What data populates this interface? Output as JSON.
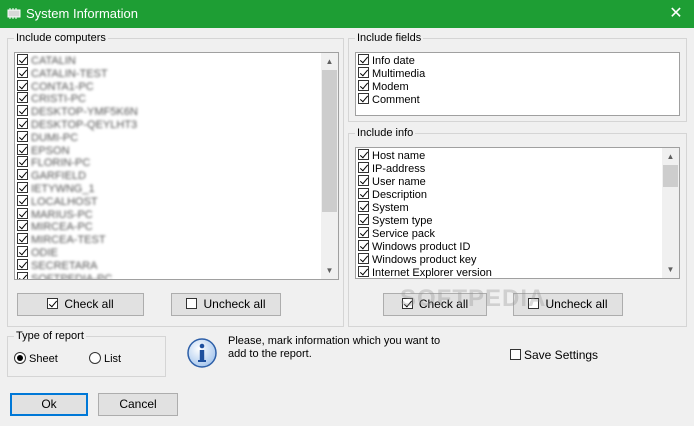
{
  "window": {
    "title": "System Information",
    "close_icon": "close-icon",
    "app_icon": "chip-icon",
    "accent": "#1e9e34"
  },
  "computers": {
    "label": "Include computers",
    "items": [
      {
        "label": "CATALIN",
        "checked": true
      },
      {
        "label": "CATALIN-TEST",
        "checked": true
      },
      {
        "label": "CONTA1-PC",
        "checked": true
      },
      {
        "label": "CRISTI-PC",
        "checked": true
      },
      {
        "label": "DESKTOP-YMF5K6N",
        "checked": true
      },
      {
        "label": "DESKTOP-QEYLHT3",
        "checked": true
      },
      {
        "label": "DUMI-PC",
        "checked": true
      },
      {
        "label": "EPSON",
        "checked": true
      },
      {
        "label": "FLORIN-PC",
        "checked": true
      },
      {
        "label": "GARFIELD",
        "checked": true
      },
      {
        "label": "IETYWNG_1",
        "checked": true
      },
      {
        "label": "LOCALHOST",
        "checked": true
      },
      {
        "label": "MARIUS-PC",
        "checked": true
      },
      {
        "label": "MIRCEA-PC",
        "checked": true
      },
      {
        "label": "MIRCEA-TEST",
        "checked": true
      },
      {
        "label": "ODIE",
        "checked": true
      },
      {
        "label": "SECRETARA",
        "checked": true
      },
      {
        "label": "SOFTPEDIA-PC",
        "checked": true
      }
    ],
    "check_all": "Check all",
    "uncheck_all": "Uncheck all",
    "scroll_position": 0.0
  },
  "fields": {
    "label": "Include fields",
    "items": [
      {
        "label": "Info date",
        "checked": true
      },
      {
        "label": "Multimedia",
        "checked": true
      },
      {
        "label": "Modem",
        "checked": true
      },
      {
        "label": "Comment",
        "checked": true
      }
    ]
  },
  "info": {
    "label": "Include info",
    "items": [
      {
        "label": "Host name",
        "checked": true
      },
      {
        "label": "IP-address",
        "checked": true
      },
      {
        "label": "User name",
        "checked": true
      },
      {
        "label": "Description",
        "checked": true
      },
      {
        "label": "System",
        "checked": true
      },
      {
        "label": "System type",
        "checked": true
      },
      {
        "label": "Service pack",
        "checked": true
      },
      {
        "label": "Windows product ID",
        "checked": true
      },
      {
        "label": "Windows product key",
        "checked": true
      },
      {
        "label": "Internet Explorer version",
        "checked": true
      }
    ],
    "check_all": "Check all",
    "uncheck_all": "Uncheck all"
  },
  "report": {
    "label": "Type of report",
    "options": [
      {
        "label": "Sheet",
        "selected": true
      },
      {
        "label": "List",
        "selected": false
      }
    ]
  },
  "notice": {
    "icon": "info-icon",
    "text_line1": "Please, mark information which you want to",
    "text_line2": "add to the report."
  },
  "save_settings": {
    "label": "Save Settings",
    "checked": false
  },
  "footer": {
    "ok": "Ok",
    "cancel": "Cancel"
  },
  "watermark": "SOFTPEDIA"
}
